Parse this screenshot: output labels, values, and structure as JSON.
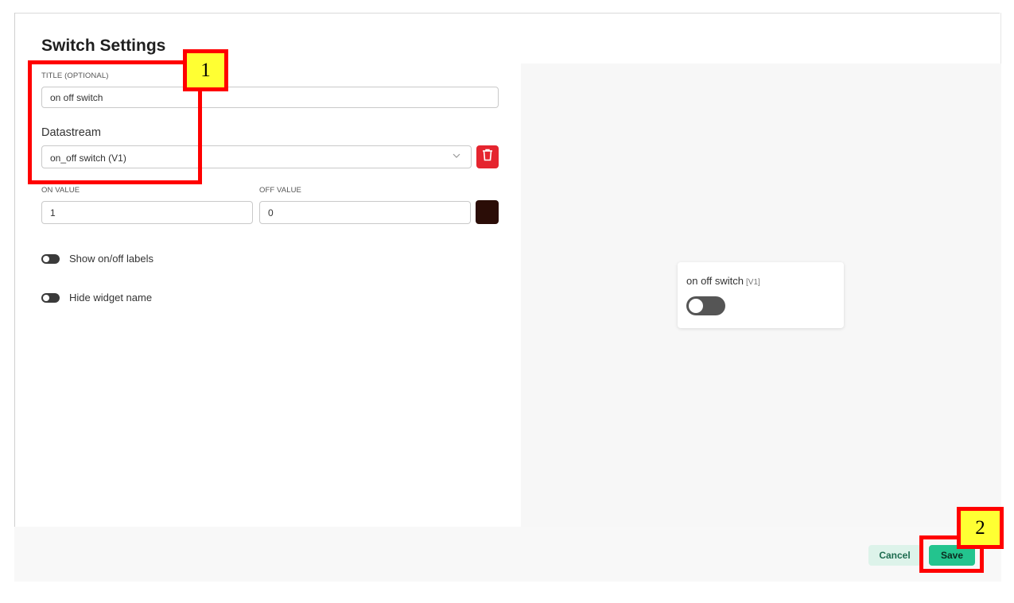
{
  "dialog": {
    "title": "Switch Settings"
  },
  "form": {
    "title_label": "TITLE (OPTIONAL)",
    "title_value": "on off switch",
    "datastream_label": "Datastream",
    "datastream_value": "on_off switch (V1)",
    "on_value_label": "ON VALUE",
    "on_value": "1",
    "off_value_label": "OFF VALUE",
    "off_value": "0",
    "show_labels_text": "Show on/off labels",
    "hide_name_text": "Hide widget name",
    "color_swatch": "#2b0d07"
  },
  "preview": {
    "widget_title": "on off switch",
    "widget_datastream": "[V1]"
  },
  "footer": {
    "cancel_label": "Cancel",
    "save_label": "Save"
  },
  "annotations": [
    {
      "label": "1"
    },
    {
      "label": "2"
    }
  ],
  "colors": {
    "accent": "#23c48e",
    "danger": "#e5252f",
    "annotation": "#ff0000",
    "annotation_fill": "#ffff33"
  }
}
